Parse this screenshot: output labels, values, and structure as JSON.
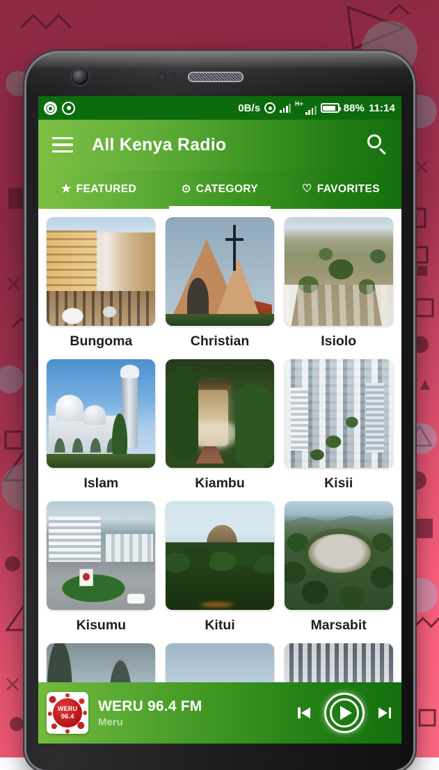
{
  "status_bar": {
    "notification_icons": [
      "app-circle-icon",
      "record-target-icon"
    ],
    "data_rate": "0B/s",
    "icons": [
      "hotspot-icon",
      "signal-bars-icon",
      "hplus-signal-icon",
      "battery-icon"
    ],
    "network_type": "H+",
    "battery_percent": "88%",
    "time": "11:14"
  },
  "app_bar": {
    "menu_icon": "hamburger-menu-icon",
    "title": "All Kenya Radio",
    "search_icon": "search-icon"
  },
  "tabs": [
    {
      "icon": "★",
      "icon_name": "star-icon",
      "label": "FEATURED",
      "active": false
    },
    {
      "icon": "⊙",
      "icon_name": "category-target-icon",
      "label": "CATEGORY",
      "active": true
    },
    {
      "icon": "♡",
      "icon_name": "heart-icon",
      "label": "FAVORITES",
      "active": false
    }
  ],
  "categories": [
    {
      "label": "Bungoma",
      "art": "ph-bungoma"
    },
    {
      "label": "Christian",
      "art": "ph-christian"
    },
    {
      "label": "Isiolo",
      "art": "ph-isiolo"
    },
    {
      "label": "Islam",
      "art": "ph-islam"
    },
    {
      "label": "Kiambu",
      "art": "ph-kiambu"
    },
    {
      "label": "Kisii",
      "art": "ph-kisii"
    },
    {
      "label": "Kisumu",
      "art": "ph-kisumu"
    },
    {
      "label": "Kitui",
      "art": "ph-kitui"
    },
    {
      "label": "Marsabit",
      "art": "ph-marsabit"
    }
  ],
  "player": {
    "station_logo": {
      "line1": "WERU",
      "line2": "96.4"
    },
    "title": "WERU 96.4 FM",
    "subtitle": "Meru",
    "previous_icon": "skip-previous-icon",
    "play_icon": "play-icon",
    "next_icon": "skip-next-icon"
  },
  "colors": {
    "app_bar_light_green": "#7dbf44",
    "app_bar_dark_green": "#14700e",
    "status_bar_green": "#0c6b0c",
    "wallpaper_maroon": "#8c2843",
    "wallpaper_pink": "#fb5f7d",
    "logo_red": "#c1191d"
  }
}
